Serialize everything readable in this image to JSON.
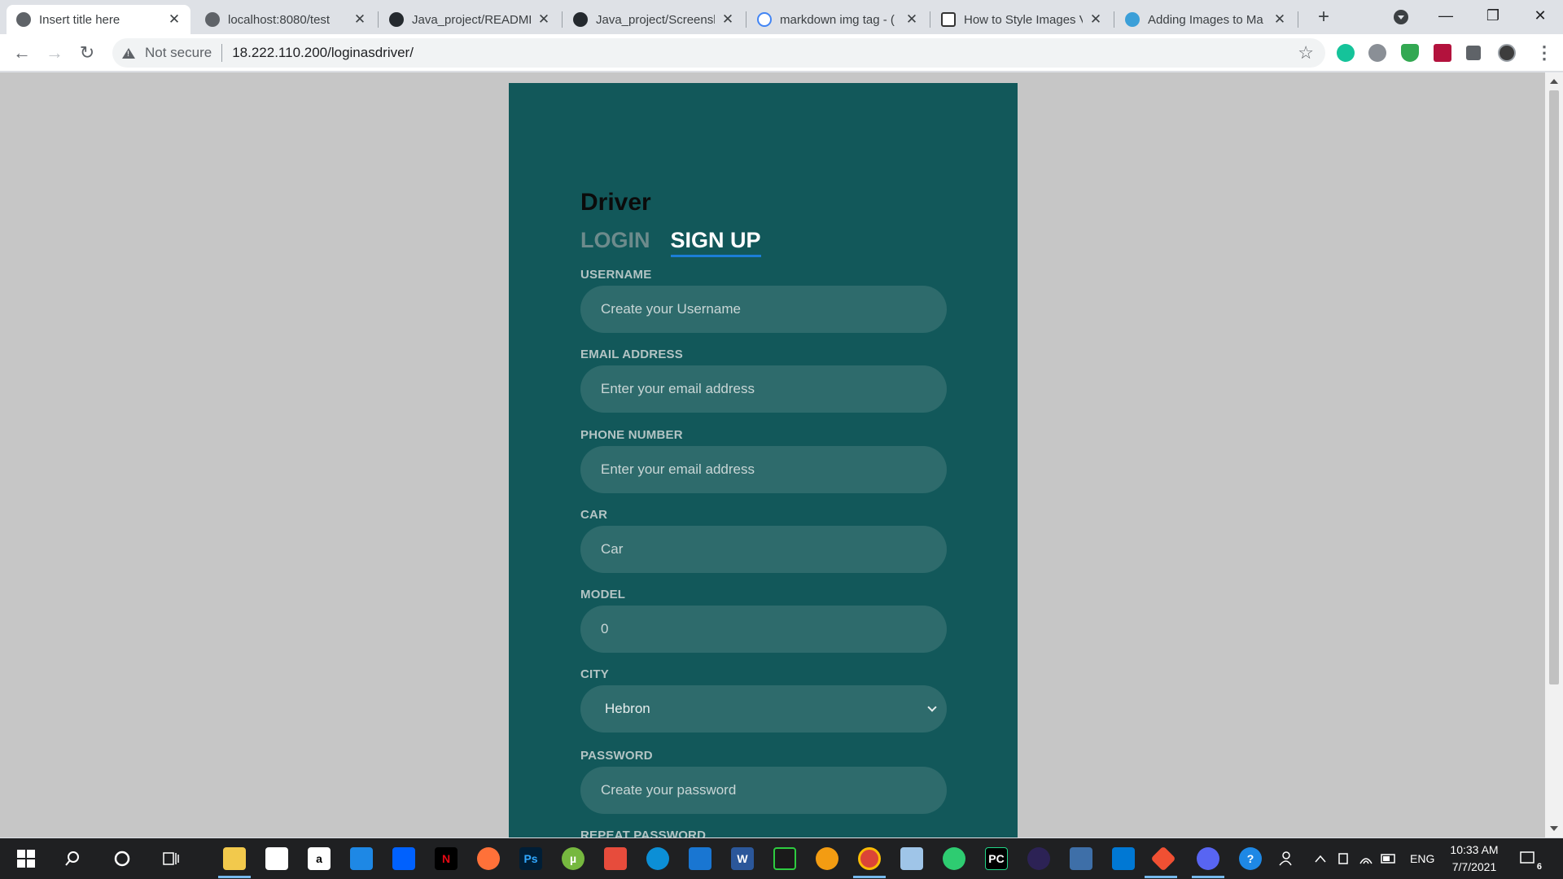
{
  "browser": {
    "tabs": [
      {
        "title": "Insert title here",
        "icon": "globe-icon",
        "active": true
      },
      {
        "title": "localhost:8080/test",
        "icon": "globe-icon"
      },
      {
        "title": "Java_project/README",
        "icon": "github-icon"
      },
      {
        "title": "Java_project/Screensh",
        "icon": "github-icon"
      },
      {
        "title": "markdown img tag - (",
        "icon": "google-icon"
      },
      {
        "title": "How to Style Images V",
        "icon": "sitepoint-icon"
      },
      {
        "title": "Adding Images to Ma",
        "icon": "earth-icon"
      }
    ],
    "close_glyph": "✕",
    "new_tab_glyph": "+",
    "window": {
      "minimize": "—",
      "maximize": "❐",
      "close": "✕"
    },
    "nav": {
      "back": "←",
      "forward": "→",
      "reload": "↻"
    },
    "address": {
      "security_text": "Not secure",
      "url": "18.222.110.200/loginasdriver/"
    },
    "bookmark_glyph": "☆",
    "menu_glyph": "⋮"
  },
  "form": {
    "title": "Driver",
    "tab_login": "LOGIN",
    "tab_signup": "SIGN UP",
    "fields": [
      {
        "label": "USERNAME",
        "value": "Create your Username"
      },
      {
        "label": "EMAIL ADDRESS",
        "value": "Enter your email address"
      },
      {
        "label": "PHONE NUMBER",
        "value": "Enter your email address"
      },
      {
        "label": "CAR",
        "value": "Car"
      },
      {
        "label": "MODEL",
        "value": "0"
      },
      {
        "label": "CITY",
        "value": "Hebron"
      },
      {
        "label": "PASSWORD",
        "value": "Create your password"
      },
      {
        "label": "REPEAT PASSWORD",
        "value": ""
      }
    ]
  },
  "taskbar": {
    "time": "10:33 AM",
    "date": "7/7/2021",
    "language": "ENG",
    "notifications": "6"
  }
}
